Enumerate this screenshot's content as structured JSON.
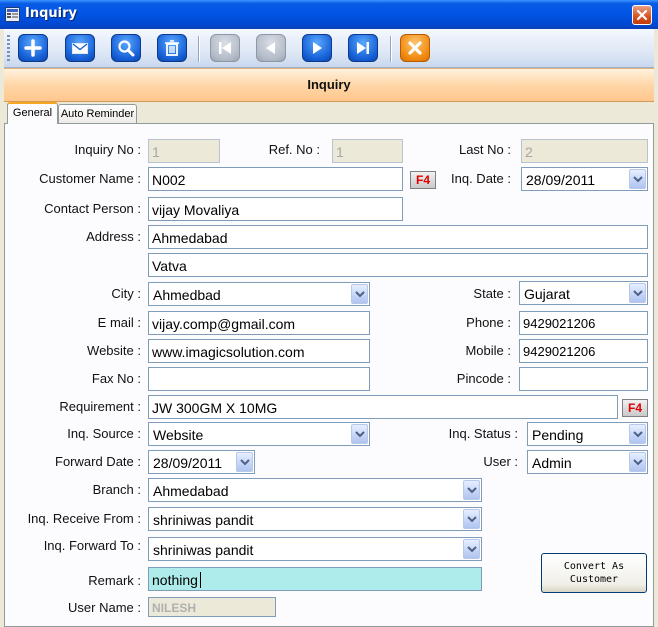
{
  "window": {
    "title": "Inquiry"
  },
  "toolbar": {
    "buttons": [
      {
        "name": "add",
        "icon": "plus-icon"
      },
      {
        "name": "mail",
        "icon": "mail-icon"
      },
      {
        "name": "search",
        "icon": "magnify-icon"
      },
      {
        "name": "delete",
        "icon": "trash-icon"
      },
      {
        "name": "first",
        "icon": "first-record-icon"
      },
      {
        "name": "previous",
        "icon": "previous-icon"
      },
      {
        "name": "next",
        "icon": "next-icon"
      },
      {
        "name": "last",
        "icon": "last-record-icon"
      },
      {
        "name": "close",
        "icon": "close-icon"
      }
    ]
  },
  "header": {
    "title": "Inquiry"
  },
  "tabs": [
    {
      "label": "General",
      "active": true
    },
    {
      "label": "Auto Reminder",
      "active": false
    }
  ],
  "labels": {
    "inquiry_no": "Inquiry No :",
    "ref_no": "Ref. No :",
    "last_no": "Last No :",
    "customer_name": "Customer Name :",
    "inq_date": "Inq. Date :",
    "contact_person": "Contact Person :",
    "address": "Address :",
    "city": "City :",
    "state": "State :",
    "email": "E mail :",
    "phone": "Phone :",
    "website": "Website :",
    "mobile": "Mobile :",
    "fax": "Fax No :",
    "pincode": "Pincode :",
    "requirement": "Requirement :",
    "inq_source": "Inq. Source :",
    "inq_status": "Inq. Status :",
    "forward_date": "Forward Date :",
    "user": "User :",
    "branch": "Branch :",
    "inq_receive_from": "Inq. Receive From :",
    "inq_forward_to": "Inq. Forward To :",
    "remark": "Remark :",
    "user_name": "User Name :"
  },
  "values": {
    "inquiry_no": "1",
    "ref_no": "1",
    "last_no": "2",
    "customer_name": "N002",
    "inq_date": "28/09/2011",
    "contact_person": "vijay Movaliya",
    "address_line1": "Ahmedabad",
    "address_line2": "Vatva",
    "city": "Ahmedbad",
    "state": "Gujarat",
    "email": "vijay.comp@gmail.com",
    "phone": "9429021206",
    "website": "www.imagicsolution.com",
    "mobile": "9429021206",
    "fax": "",
    "pincode": "",
    "requirement": "JW 300GM X 10MG",
    "inq_source": "Website",
    "inq_status": "Pending",
    "forward_date": "28/09/2011",
    "user": "Admin",
    "branch": "Ahmedabad",
    "inq_receive_from": "shriniwas pandit",
    "inq_forward_to": "shriniwas pandit",
    "remark": "nothing",
    "user_name": "NILESH"
  },
  "f4_label": "F4",
  "convert_button": {
    "line1": "Convert As",
    "line2": "Customer"
  },
  "colors": {
    "titlebar": "#0054e3",
    "banner": "#ffd7a8",
    "remark_bg": "#aeeceb",
    "f4_text": "#e00000"
  }
}
